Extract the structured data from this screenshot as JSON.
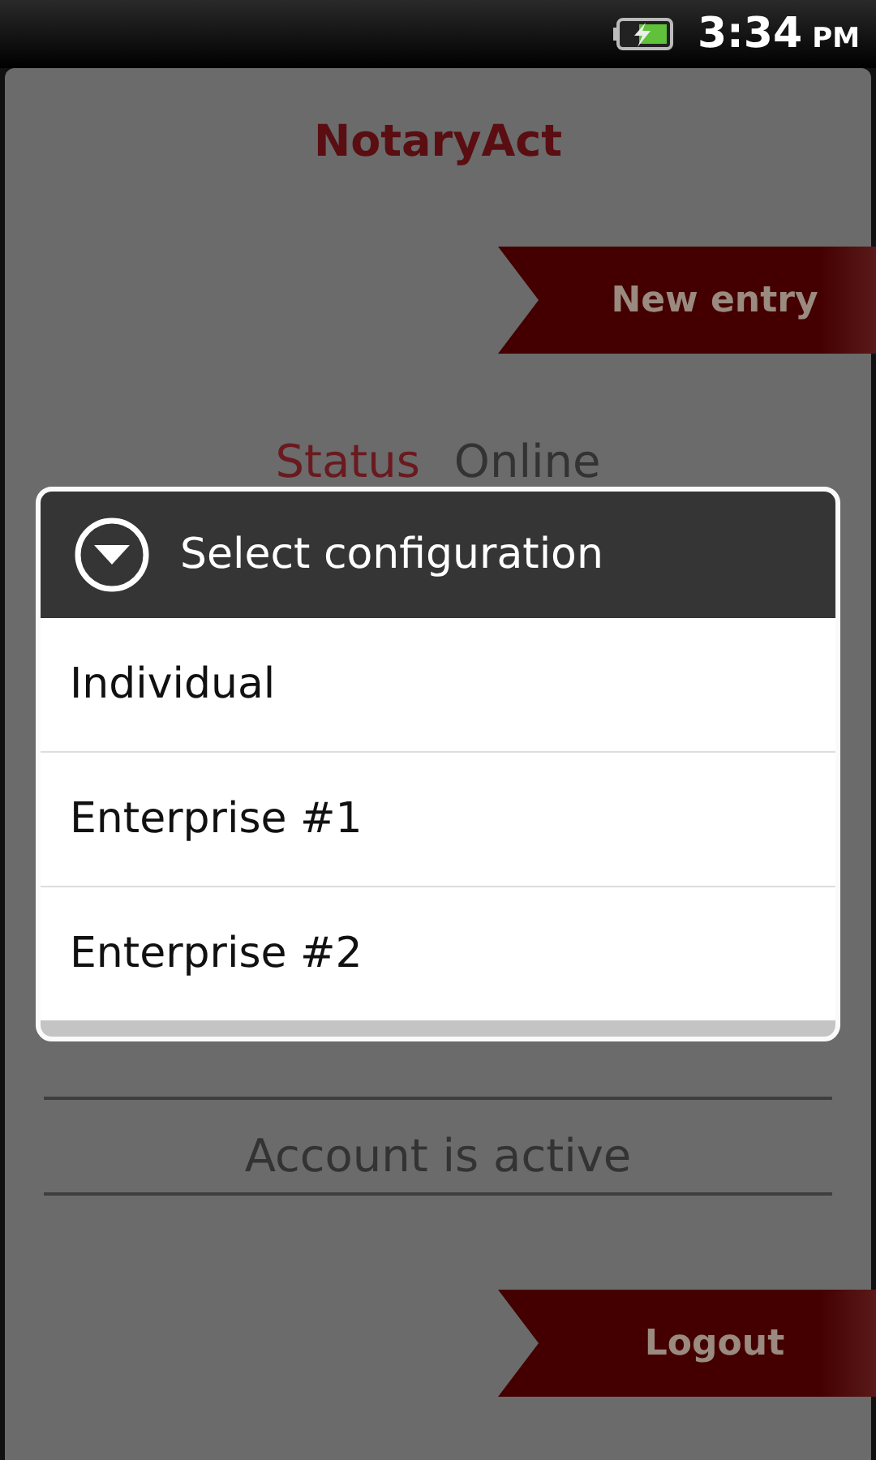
{
  "status_bar": {
    "time": "3:34",
    "meridiem": "PM"
  },
  "app": {
    "title": "NotaryAct",
    "new_entry_button": "New entry",
    "status_label": "Status",
    "status_value": "Online",
    "account_state": "Account is active",
    "logout_button": "Logout"
  },
  "dialog": {
    "title": "Select configuration",
    "options": [
      {
        "label": "Individual"
      },
      {
        "label": "Enterprise #1"
      },
      {
        "label": "Enterprise #2"
      }
    ]
  }
}
